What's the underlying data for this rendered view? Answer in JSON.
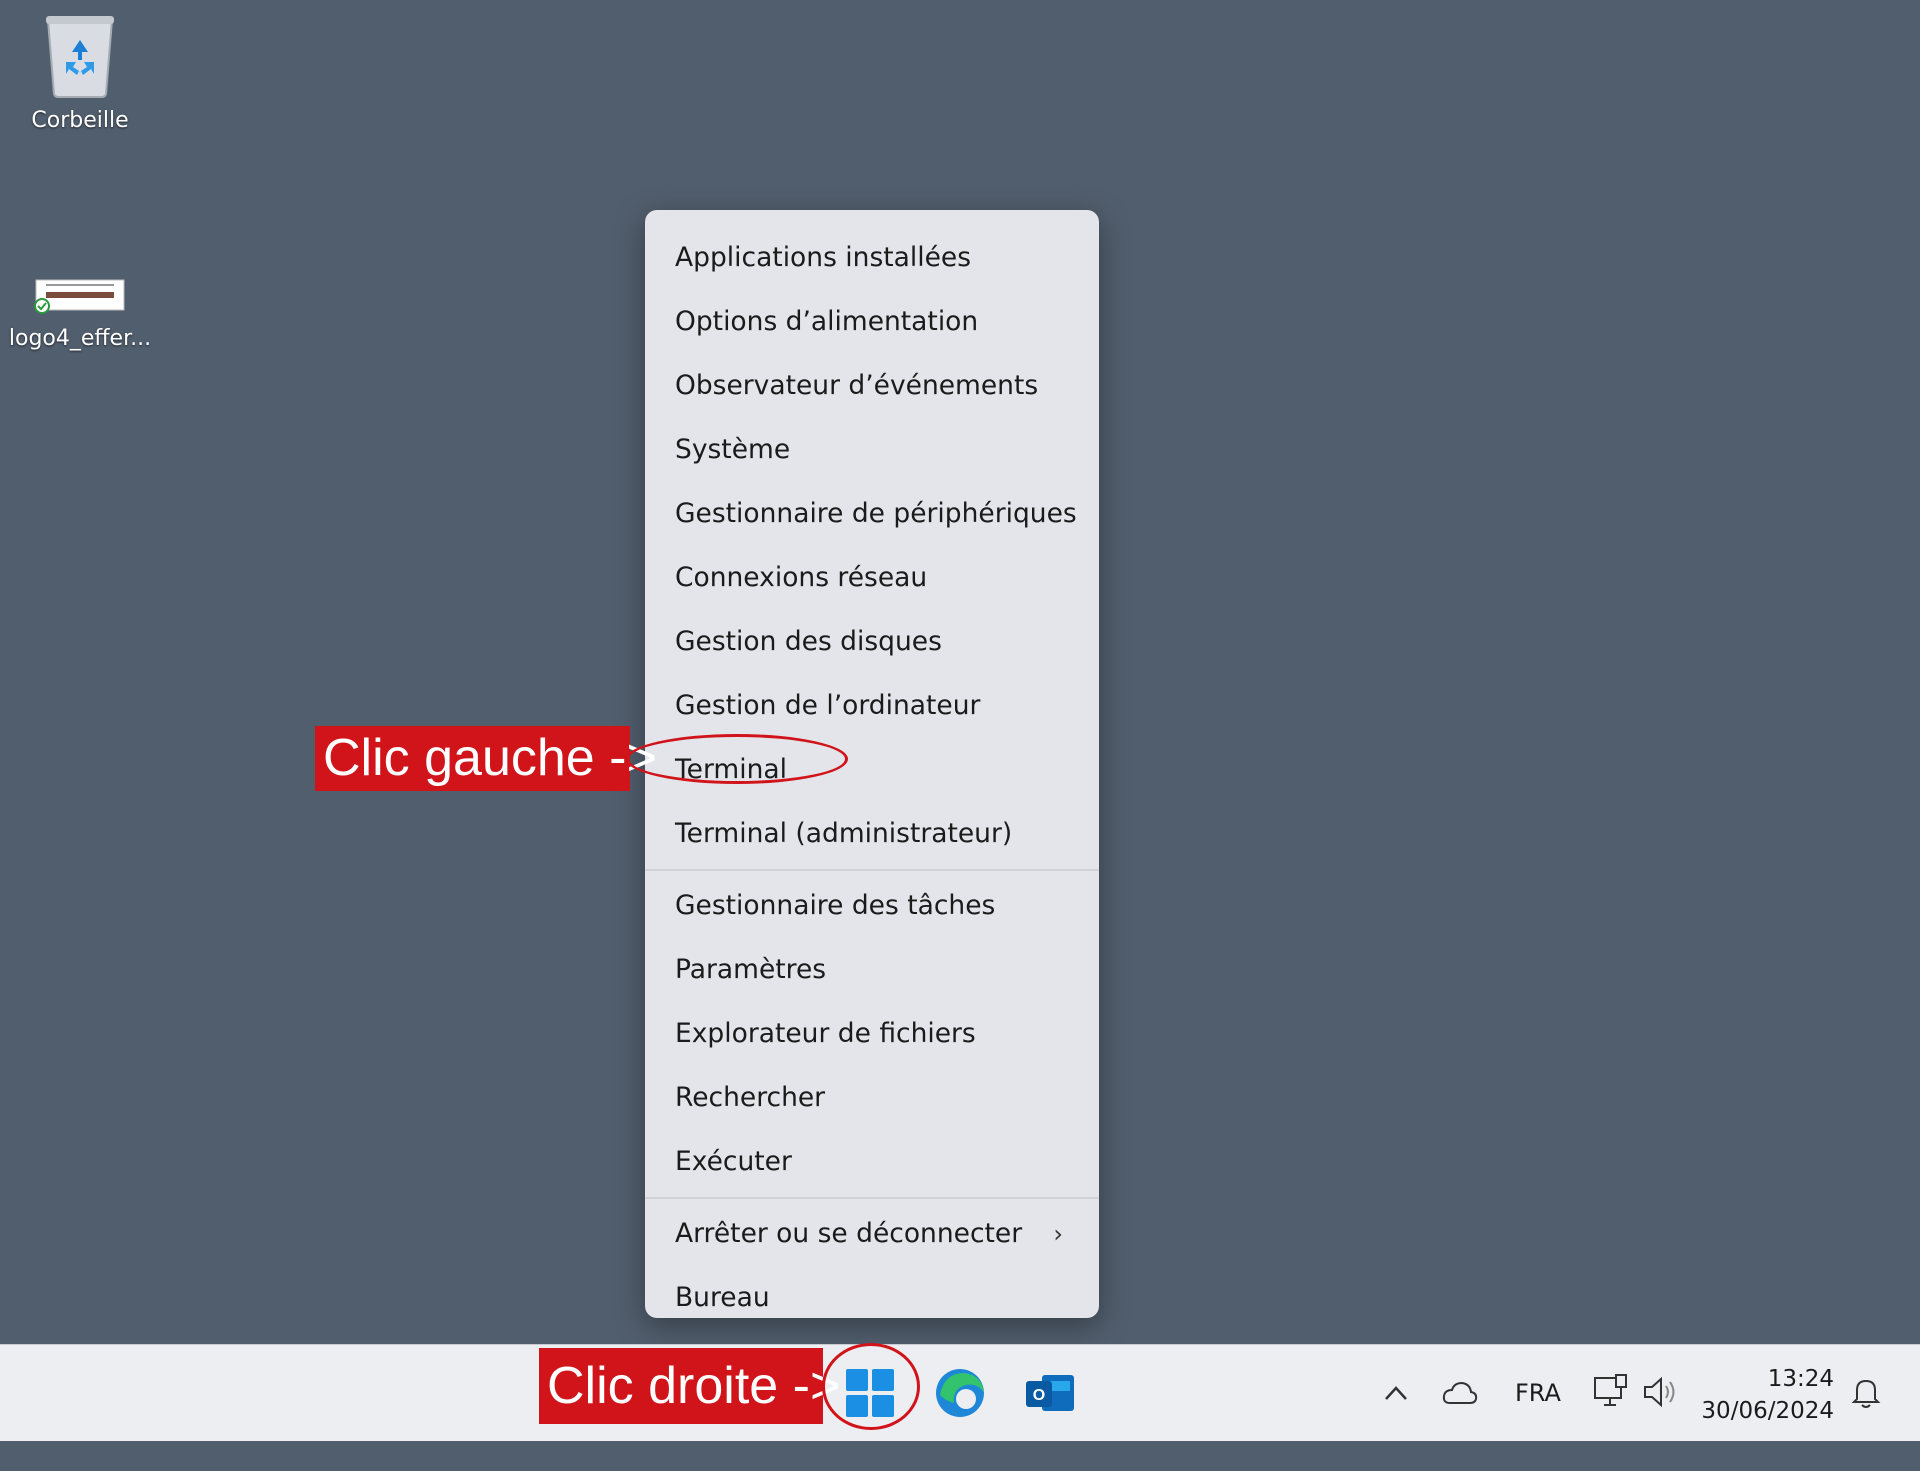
{
  "desktop": {
    "icons": [
      {
        "label": "Corbeille"
      },
      {
        "label": "logo4_effer..."
      }
    ]
  },
  "context_menu": {
    "group1": [
      "Applications installées",
      "Options d’alimentation",
      "Observateur d’événements",
      "Système",
      "Gestionnaire de périphériques",
      "Connexions réseau",
      "Gestion des disques",
      "Gestion de l’ordinateur",
      "Terminal",
      "Terminal (administrateur)"
    ],
    "group2": [
      "Gestionnaire des tâches",
      "Paramètres",
      "Explorateur de fichiers",
      "Rechercher",
      "Exécuter"
    ],
    "group3": [
      "Arrêter ou se déconnecter",
      "Bureau"
    ]
  },
  "annotations": {
    "left": "Clic gauche ->",
    "right": "Clic droite ->"
  },
  "taskbar": {
    "language": "FRA",
    "time": "13:24",
    "date": "30/06/2024"
  },
  "colors": {
    "desktop_bg": "#515e6d",
    "menu_bg": "#e3e5ea",
    "annotation_red": "#d0141a",
    "taskbar_bg": "#edeef2",
    "windows_blue": "#1a8fe3"
  }
}
